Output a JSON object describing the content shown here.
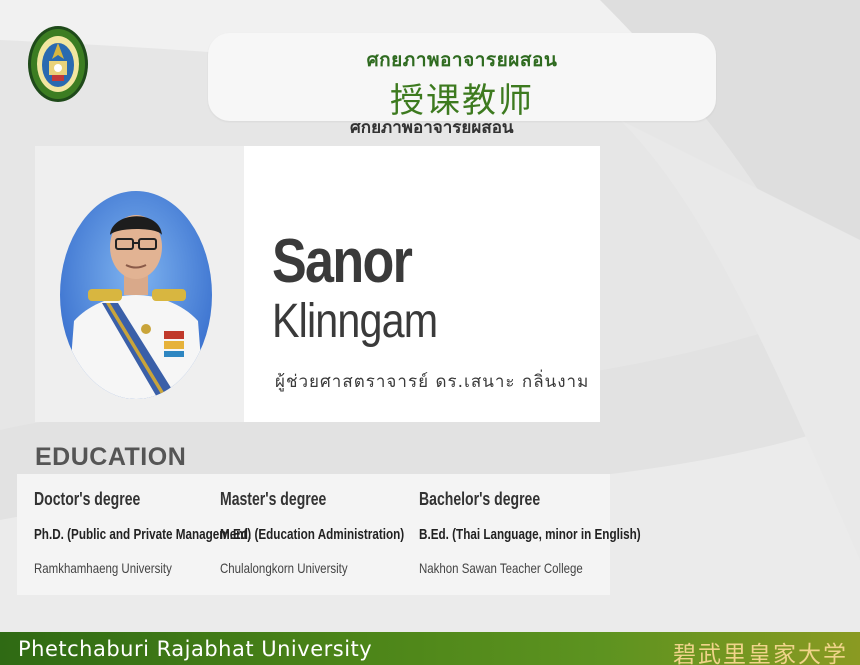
{
  "header": {
    "title_thai": "ศกยภาพอาจารยผสอน",
    "title_chinese": "授课教师",
    "partial_line": "ศกยภาพอาจารยผสอน"
  },
  "profile": {
    "first_name": "Sanor",
    "last_name": "Klinngam",
    "thai_title_name": "ผู้ช่วยศาสตราจารย์ ดร.เสนาะ กลิ่นงาม"
  },
  "education": {
    "heading": "EDUCATION",
    "degrees": [
      {
        "level": "Doctor's degree",
        "major": "Ph.D. (Public and Private Management)",
        "university": "Ramkhamhaeng University"
      },
      {
        "level": "Master's degree",
        "major": "M.Ed. (Education Administration)",
        "university": "Chulalongkorn University"
      },
      {
        "level": "Bachelor's degree",
        "major": "B.Ed. (Thai Language, minor in English)",
        "university": "Nakhon Sawan Teacher College"
      }
    ]
  },
  "footer": {
    "university_en": "Phetchaburi Rajabhat University",
    "university_cn": "碧武里皇家大学"
  },
  "colors": {
    "accent_green": "#2f6b20",
    "footer_gold": "#f0d48a"
  },
  "icons": {
    "logo": "university-seal-icon",
    "photo": "portrait-photo"
  }
}
